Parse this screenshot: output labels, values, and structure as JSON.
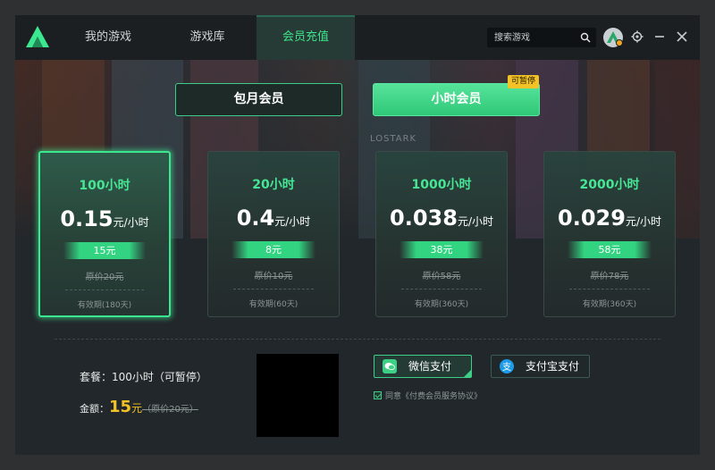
{
  "nav": {
    "tabs": [
      {
        "label": "我的游戏"
      },
      {
        "label": "游戏库"
      },
      {
        "label": "会员充值"
      }
    ],
    "search_placeholder": "搜索游戏"
  },
  "hero": {
    "game_texts": [
      "LOSTARK"
    ]
  },
  "plans": {
    "monthly_label": "包月会员",
    "hourly_label": "小时会员",
    "pause_badge": "可暂停"
  },
  "cards": [
    {
      "title": "100小时",
      "price": "0.15",
      "unit": "元/小时",
      "tag": "15元",
      "orig": "原价20元",
      "valid": "有效期(180天)"
    },
    {
      "title": "20小时",
      "price": "0.4",
      "unit": "元/小时",
      "tag": "8元",
      "orig": "原价10元",
      "valid": "有效期(60天)"
    },
    {
      "title": "1000小时",
      "price": "0.038",
      "unit": "元/小时",
      "tag": "38元",
      "orig": "原价58元",
      "valid": "有效期(360天)"
    },
    {
      "title": "2000小时",
      "price": "0.029",
      "unit": "元/小时",
      "tag": "58元",
      "orig": "原价78元",
      "valid": "有效期(360天)"
    }
  ],
  "footer": {
    "package_text": "套餐：100小时（可暂停）",
    "amount_label": "金额：",
    "amount_value": "15",
    "amount_unit": "元",
    "amount_orig": "（原价20元）",
    "wechat_label": "微信支付",
    "alipay_label": "支付宝支付",
    "agreement": "同意《付费会员服务协议》"
  },
  "colors": {
    "accent": "#3ce88f",
    "highlight": "#f2c227",
    "background": "#22272b"
  },
  "icons": [
    "app-logo-icon",
    "search-icon",
    "avatar",
    "settings-icon",
    "minimize-icon",
    "close-icon",
    "wechat-icon",
    "alipay-icon",
    "checkbox-icon"
  ]
}
